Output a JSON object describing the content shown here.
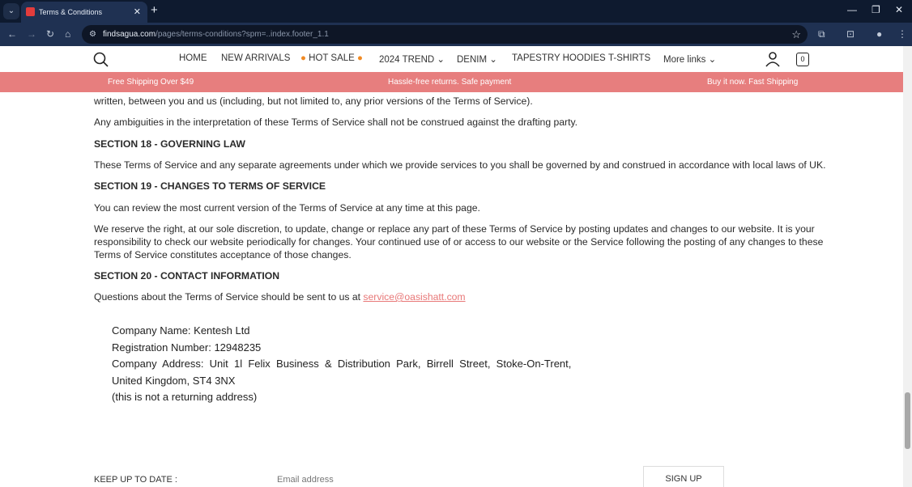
{
  "browser": {
    "tab_title": "Terms & Conditions",
    "url_domain": "findsagua.com",
    "url_path": "/pages/terms-conditions?spm=..index.footer_1.1"
  },
  "site": {
    "nav": [
      "HOME",
      "NEW ARRIVALS",
      "HOT SALE",
      "2024 TREND",
      "DENIM",
      "TAPESTRY HOODIES",
      "T-SHIRTS",
      "More links"
    ],
    "cart_count": "0",
    "banner": [
      "Free Shipping Over $49",
      "Hassle-free returns. Safe payment",
      "Buy it now. Fast Shipping"
    ],
    "colors": {
      "banner": "#e77e7e",
      "link": "#e87878"
    }
  },
  "content": {
    "partial_line": "written, between you and us (including, but not limited to, any prior versions of the Terms of Service).",
    "ambiguity": "Any ambiguities in the interpretation of these Terms of Service shall not be construed against the drafting party.",
    "s18_title": "SECTION 18 - GOVERNING LAW",
    "s18_text": "These Terms of Service and any separate agreements under which we provide services to you shall be governed by and construed in accordance with local laws of UK.",
    "s19_title": "SECTION 19 - CHANGES TO TERMS OF SERVICE",
    "s19_text1": "You can review the most current version of the Terms of Service at any time at this page.",
    "s19_text2_l1": "We reserve the right, at our sole discretion, to update, change or replace any part of these Terms of Service by posting updates and changes to our website. It is your",
    "s19_text2_l2": "responsibility to check our website periodically for changes. Your continued use of or access to our website or the Service following the posting of any changes to these",
    "s19_text2_l3": "Terms of Service constitutes acceptance of those changes.",
    "s20_title": "SECTION 20 - CONTACT INFORMATION",
    "s20_text": "Questions about the Terms of Service should be sent to us at ",
    "s20_email": "service@oasishatt.com",
    "company": [
      "Company Name: Kentesh Ltd",
      "Registration Number: 12948235",
      "Company  Address:  Unit  1l  Felix  Business  &  Distribution  Park,  Birrell  Street,  Stoke-On-Trent,",
      "United Kingdom, ST4 3NX",
      "(this is not a returning address)"
    ]
  },
  "footer": {
    "keep_label": "KEEP UP TO DATE :",
    "email_placeholder": "Email address",
    "signup": "SIGN UP"
  }
}
